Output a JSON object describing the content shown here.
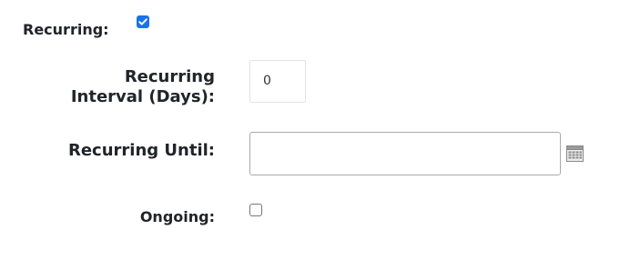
{
  "form": {
    "recurring_label": "Recurring:",
    "recurring_checked": true,
    "interval_label_line1": "Recurring",
    "interval_label_line2": "Interval (Days):",
    "interval_value": "0",
    "until_label": "Recurring Until:",
    "until_value": "",
    "calendar_icon": "calendar-icon",
    "ongoing_label": "Ongoing:",
    "ongoing_checked": false
  },
  "colors": {
    "checkbox_accent": "#1a73e8"
  }
}
